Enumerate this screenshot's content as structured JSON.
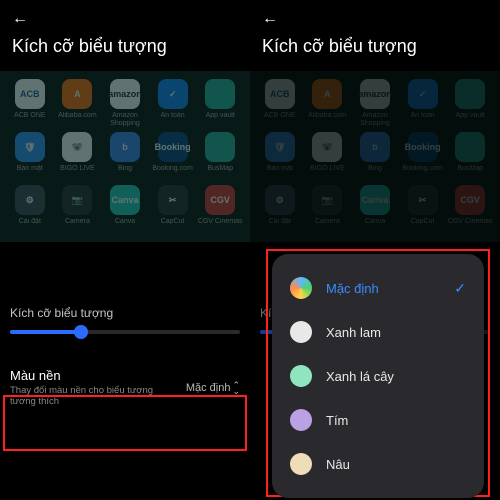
{
  "header": {
    "title": "Kích cỡ biểu tượng"
  },
  "apps": [
    {
      "label": "ACB ONE",
      "class": "i-acb",
      "txt": "ACB"
    },
    {
      "label": "Alibaba.com",
      "class": "i-ali",
      "txt": "A"
    },
    {
      "label": "Amazon Shopping",
      "class": "i-amz",
      "txt": "amazon"
    },
    {
      "label": "An toàn",
      "class": "i-at",
      "txt": "✓"
    },
    {
      "label": "App vault",
      "class": "i-av",
      "txt": ""
    },
    {
      "label": "Bảo mật",
      "class": "i-bm",
      "txt": "🛡"
    },
    {
      "label": "BIGO LIVE",
      "class": "i-bigo",
      "txt": "🐨"
    },
    {
      "label": "Bing",
      "class": "i-bing",
      "txt": "b"
    },
    {
      "label": "Booking.com",
      "class": "i-bk",
      "txt": "Booking"
    },
    {
      "label": "BusMap",
      "class": "i-bus",
      "txt": ""
    },
    {
      "label": "Cài đặt",
      "class": "i-cd",
      "txt": "⚙"
    },
    {
      "label": "Camera",
      "class": "i-cam",
      "txt": "📷"
    },
    {
      "label": "Canva",
      "class": "i-can",
      "txt": "Canva"
    },
    {
      "label": "CapCut",
      "class": "i-cap",
      "txt": "✂"
    },
    {
      "label": "CGV Cinemas",
      "class": "i-cgv",
      "txt": "CGV"
    }
  ],
  "size_label": "Kích cỡ biểu tượng",
  "bg": {
    "title": "Màu nền",
    "desc": "Thay đổi màu nền cho biểu tượng tương thích",
    "value": "Mặc định"
  },
  "popup": {
    "items": [
      {
        "label": "Mặc định",
        "swatch": "sw-def",
        "selected": true
      },
      {
        "label": "Xanh lam",
        "swatch": "sw-blue",
        "selected": false
      },
      {
        "label": "Xanh lá cây",
        "swatch": "sw-green",
        "selected": false
      },
      {
        "label": "Tím",
        "swatch": "sw-purple",
        "selected": false
      },
      {
        "label": "Nâu",
        "swatch": "sw-brown",
        "selected": false
      }
    ]
  }
}
